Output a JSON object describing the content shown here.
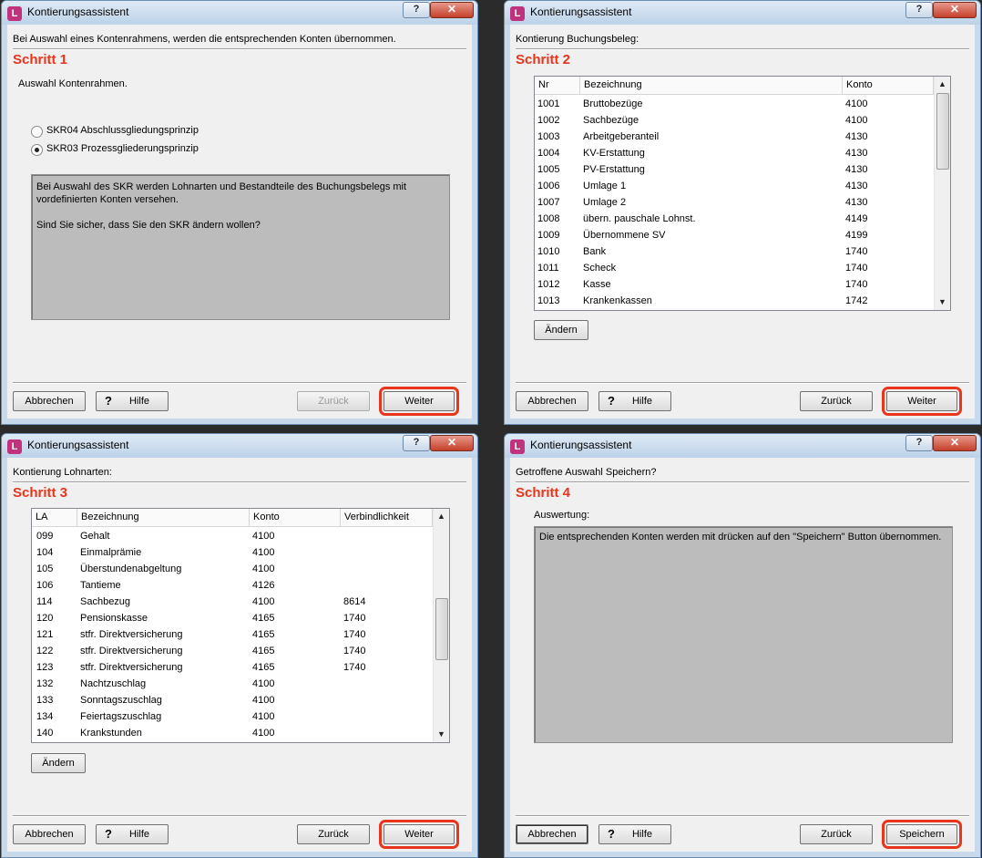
{
  "window_title": "Kontierungsassistent",
  "help_glyph": "?",
  "close_glyph": "✕",
  "buttons": {
    "cancel": "Abbrechen",
    "help": "Hilfe",
    "help_glyph": "?",
    "back": "Zurück",
    "next": "Weiter",
    "save": "Speichern",
    "change": "Ändern"
  },
  "step1": {
    "header": "Bei Auswahl eines Kontenrahmens, werden die entsprechenden Konten übernommen.",
    "step_label": "Schritt 1",
    "prompt": "Auswahl Kontenrahmen.",
    "options": [
      {
        "label": "SKR04 Abschlussgliedungsprinzip",
        "checked": false
      },
      {
        "label": "SKR03 Prozessgliederungsprinzip",
        "checked": true
      }
    ],
    "info_line1": "Bei Auswahl des SKR werden Lohnarten und Bestandteile des Buchungsbelegs mit",
    "info_line2": "vordefinierten Konten versehen.",
    "info_line3": "Sind Sie sicher, dass Sie den SKR ändern wollen?"
  },
  "step2": {
    "header": "Kontierung Buchungsbeleg:",
    "step_label": "Schritt 2",
    "columns": [
      "Nr",
      "Bezeichnung",
      "Konto"
    ],
    "rows": [
      [
        "1001",
        "Bruttobezüge",
        "4100"
      ],
      [
        "1002",
        "Sachbezüge",
        "4100"
      ],
      [
        "1003",
        "Arbeitgeberanteil",
        "4130"
      ],
      [
        "1004",
        "KV-Erstattung",
        "4130"
      ],
      [
        "1005",
        "PV-Erstattung",
        "4130"
      ],
      [
        "1006",
        "Umlage 1",
        "4130"
      ],
      [
        "1007",
        "Umlage 2",
        "4130"
      ],
      [
        "1008",
        "übern. pauschale Lohnst.",
        "4149"
      ],
      [
        "1009",
        "Übernommene SV",
        "4199"
      ],
      [
        "1010",
        "Bank",
        "1740"
      ],
      [
        "1011",
        "Scheck",
        "1740"
      ],
      [
        "1012",
        "Kasse",
        "1740"
      ],
      [
        "1013",
        "Krankenkassen",
        "1742"
      ]
    ]
  },
  "step3": {
    "header": "Kontierung Lohnarten:",
    "step_label": "Schritt 3",
    "columns": [
      "LA",
      "Bezeichnung",
      "Konto",
      "Verbindlichkeit"
    ],
    "rows": [
      [
        "099",
        "Gehalt",
        "4100",
        ""
      ],
      [
        "104",
        "Einmalprämie",
        "4100",
        ""
      ],
      [
        "105",
        "Überstundenabgeltung",
        "4100",
        ""
      ],
      [
        "106",
        "Tantieme",
        "4126",
        ""
      ],
      [
        "114",
        "Sachbezug",
        "4100",
        "8614"
      ],
      [
        "120",
        "Pensionskasse",
        "4165",
        "1740"
      ],
      [
        "121",
        "stfr. Direktversicherung",
        "4165",
        "1740"
      ],
      [
        "122",
        "stfr. Direktversicherung",
        "4165",
        "1740"
      ],
      [
        "123",
        "stfr. Direktversicherung",
        "4165",
        "1740"
      ],
      [
        "132",
        "Nachtzuschlag",
        "4100",
        ""
      ],
      [
        "133",
        "Sonntagszuschlag",
        "4100",
        ""
      ],
      [
        "134",
        "Feiertagszuschlag",
        "4100",
        ""
      ],
      [
        "140",
        "Krankstunden",
        "4100",
        ""
      ]
    ]
  },
  "step4": {
    "header": "Getroffene Auswahl Speichern?",
    "step_label": "Schritt 4",
    "eval_label": "Auswertung:",
    "eval_text": "Die entsprechenden Konten werden mit drücken auf den \"Speichern\" Button übernommen."
  },
  "scroll": {
    "up": "▲",
    "down": "▼"
  },
  "colors": {
    "step_red": "#e8351c",
    "titlebar": "#c7d9ea",
    "client": "#f0f0f0",
    "info_grey": "#bcbcbc"
  }
}
